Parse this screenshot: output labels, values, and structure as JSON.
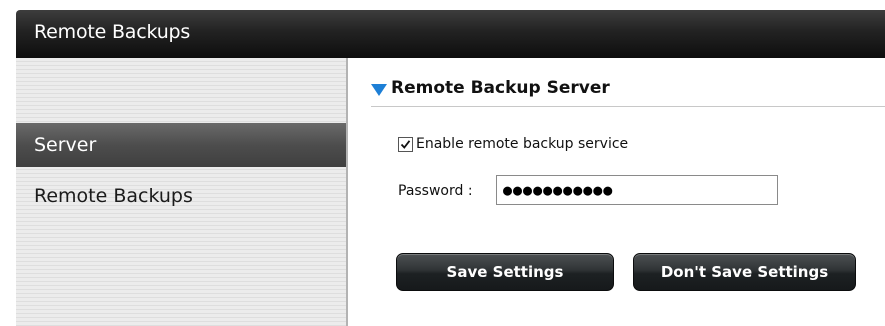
{
  "window": {
    "title": "Remote Backups"
  },
  "sidebar": {
    "items": [
      {
        "label": "Server",
        "active": true
      },
      {
        "label": "Remote Backups",
        "active": false
      }
    ]
  },
  "main": {
    "section_title": "Remote Backup Server",
    "enable_checkbox": {
      "label": "Enable remote backup service",
      "checked": true
    },
    "password": {
      "label": "Password :",
      "value": "●●●●●●●●●●●"
    },
    "buttons": {
      "save_label": "Save Settings",
      "dont_save_label": "Don't Save Settings"
    }
  },
  "colors": {
    "accent_triangle": "#1d7fd6",
    "title_bar": "#1a1a1a",
    "button": "#2a2e30"
  }
}
